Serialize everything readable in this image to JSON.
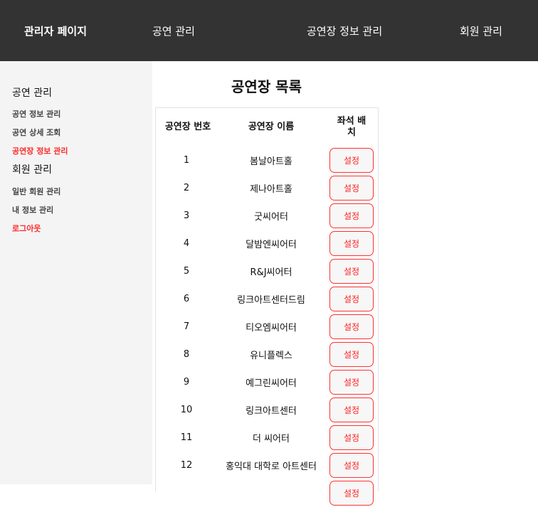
{
  "nav": {
    "brand": "관리자 페이지",
    "items": [
      "공연 관리",
      "공연장 정보 관리",
      "회원 관리"
    ]
  },
  "sidebar": {
    "section1": "공연 관리",
    "items1": [
      "공연 정보 관리",
      "공연 상세 조회",
      "공연장 정보 관리"
    ],
    "section2": "회원 관리",
    "items2": [
      "일반 회원 관리",
      "내 정보 관리",
      "로그아웃"
    ]
  },
  "main": {
    "title": "공연장 목록",
    "headers": [
      "공연장 번호",
      "공연장 이름",
      "좌석 배치"
    ],
    "button_label": "설정",
    "rows": [
      {
        "no": "1",
        "name": "봄날아트홀"
      },
      {
        "no": "2",
        "name": "제나아트홀"
      },
      {
        "no": "3",
        "name": "굿씨어터"
      },
      {
        "no": "4",
        "name": "달밤엔씨어터"
      },
      {
        "no": "5",
        "name": "R&J씨어터"
      },
      {
        "no": "6",
        "name": "링크아트센터드림"
      },
      {
        "no": "7",
        "name": "티오엠씨어터"
      },
      {
        "no": "8",
        "name": "유니플렉스"
      },
      {
        "no": "9",
        "name": "예그린씨어터"
      },
      {
        "no": "10",
        "name": "링크아트센터"
      },
      {
        "no": "11",
        "name": "더 씨어터"
      },
      {
        "no": "12",
        "name": "홍익대 대학로 아트센터"
      }
    ]
  }
}
